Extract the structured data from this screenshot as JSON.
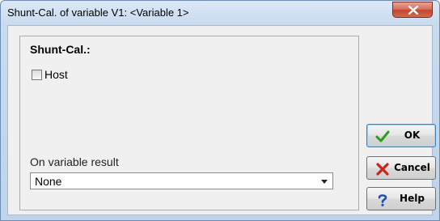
{
  "window": {
    "title": "Shunt-Cal. of variable V1: <Variable 1>",
    "close_icon": "close-icon"
  },
  "group": {
    "title": "Shunt-Cal.:",
    "host_checkbox": {
      "label": "Host",
      "checked": false
    },
    "variable_result": {
      "label": "On variable result",
      "selected": "None"
    }
  },
  "buttons": {
    "ok": {
      "label": "OK",
      "icon": "checkmark-icon",
      "icon_color": "#2e9c1a"
    },
    "cancel": {
      "label": "Cancel",
      "icon": "x-icon",
      "icon_color": "#c8261a"
    },
    "help": {
      "label": "Help",
      "icon": "question-icon",
      "icon_color": "#1e4fb8"
    }
  }
}
